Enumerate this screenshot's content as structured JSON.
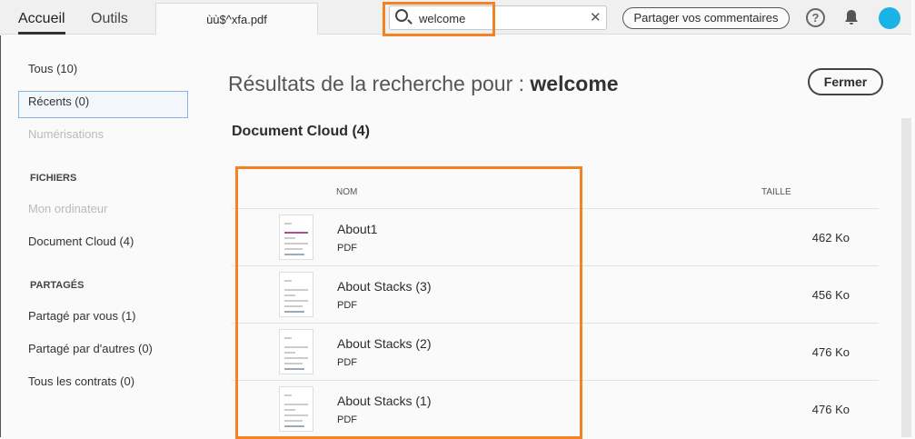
{
  "topbar": {
    "tabs": [
      "Accueil",
      "Outils"
    ],
    "document_tab": "ùù$^xfa.pdf",
    "search_value": "welcome",
    "share_label": "Partager vos commentaires",
    "help": "?"
  },
  "sidebar": {
    "items": [
      "Tous (10)",
      "Récents (0)",
      "Numérisations"
    ],
    "files_header": "FICHIERS",
    "files": [
      "Mon ordinateur",
      "Document Cloud (4)"
    ],
    "shared_header": "PARTAGÉS",
    "shared": [
      "Partagé par vous (1)",
      "Partagé par d'autres (0)",
      "Tous les contrats (0)"
    ]
  },
  "main": {
    "title_prefix": "Résultats de la recherche pour : ",
    "query": "welcome",
    "close_label": "Fermer",
    "section": "Document Cloud (4)",
    "col_name": "NOM",
    "col_size": "TAILLE",
    "rows": [
      {
        "name": "About1",
        "type": "PDF",
        "size": "462 Ko"
      },
      {
        "name": "About Stacks (3)",
        "type": "PDF",
        "size": "456 Ko"
      },
      {
        "name": "About Stacks (2)",
        "type": "PDF",
        "size": "476 Ko"
      },
      {
        "name": "About Stacks (1)",
        "type": "PDF",
        "size": "476 Ko"
      }
    ]
  }
}
